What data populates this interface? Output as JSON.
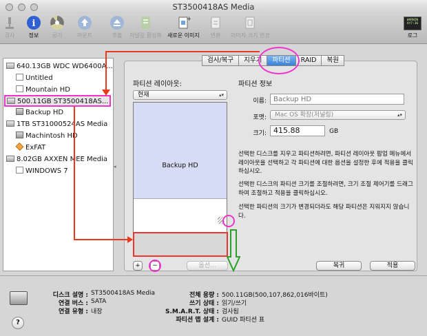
{
  "window": {
    "title": "ST3500418AS Media"
  },
  "toolbar": {
    "items": [
      {
        "label": "검사",
        "icon": "microscope-icon",
        "enabled": false
      },
      {
        "label": "정보",
        "icon": "info-icon",
        "enabled": true
      },
      {
        "label": "굽기",
        "icon": "burn-icon",
        "enabled": false
      },
      {
        "label": "마운트",
        "icon": "mount-icon",
        "enabled": false
      },
      {
        "label": "추출",
        "icon": "eject-icon",
        "enabled": false
      },
      {
        "label": "저널링 활성화",
        "icon": "journal-icon",
        "enabled": false
      },
      {
        "label": "새로운 이미지",
        "icon": "new-image-icon",
        "enabled": true
      },
      {
        "label": "변환",
        "icon": "convert-icon",
        "enabled": false
      },
      {
        "label": "이미지 크기 변경",
        "icon": "resize-image-icon",
        "enabled": false
      }
    ],
    "log": {
      "label": "로그",
      "screen_text": "WARNIN\nAY7:36"
    }
  },
  "sidebar": {
    "disks": [
      {
        "label": "640.13GB WDC WD6400A...",
        "volumes": [
          "Untitled",
          "Mountain HD"
        ]
      },
      {
        "label": "500.11GB ST3500418AS...",
        "volumes": [
          "Backup HD"
        ],
        "selected": true
      },
      {
        "label": "1TB ST31000524AS Media",
        "volumes": [
          "Machintosh HD",
          "ExFAT"
        ]
      },
      {
        "label": "8.02GB AXXEN MEE Media",
        "volumes": [
          "WINDOWS 7"
        ]
      }
    ]
  },
  "tabs": [
    "검사/복구",
    "지우기",
    "파티션",
    "RAID",
    "복원"
  ],
  "active_tab": "파티션",
  "partition": {
    "layout_label": "파티션 레이아웃:",
    "layout_value": "현재",
    "partition_name": "Backup HD",
    "options_label": "옵션...",
    "add_label": "+",
    "remove_label": "−",
    "info_title": "파티션 정보",
    "name_label": "이름:",
    "name_placeholder": "Backup HD",
    "format_label": "포맷:",
    "format_value": "Mac OS 확장(저널링)",
    "size_label": "크기:",
    "size_value": "415.88",
    "size_unit": "GB",
    "info_text_1": "선택한 디스크를 지우고 파티션하려면, 파티션 레이아웃 팝업 메뉴에서 레이아웃을 선택하고 각 파티션에 대한 옵션을 설정한 후에 적용을 클릭하십시오.",
    "info_text_2": "선택한 디스크의 파티션 크기를 조절하려면, 크기 조절 제어기를 드래그하여 조절하고 적용을 클릭하십시오.",
    "info_text_3": "선택한 파티션의 크기가 변경되더라도 해당 파티션은 지워지지 않습니다.",
    "revert_label": "복귀",
    "apply_label": "적용"
  },
  "disk_info": {
    "left": [
      {
        "label": "디스크 설명 :",
        "value": "ST3500418AS Media"
      },
      {
        "label": "연결 버스 :",
        "value": "SATA"
      },
      {
        "label": "연결 유형 :",
        "value": "내장"
      }
    ],
    "right": [
      {
        "label": "전체 용량 :",
        "value": "500.11GB(500,107,862,016바이트)"
      },
      {
        "label": "쓰기 상태 :",
        "value": "읽기/쓰기"
      },
      {
        "label": "S.M.A.R.T. 상태 :",
        "value": "검사됨"
      },
      {
        "label": "파티션 맵 설계 :",
        "value": "GUID 파티션 표"
      }
    ],
    "help_label": "?"
  },
  "colors": {
    "annotation_red": "#e63a1a",
    "annotation_magenta": "#ee33cc",
    "annotation_green": "#2aa02a",
    "partition_blue": "#d6dbf6"
  }
}
